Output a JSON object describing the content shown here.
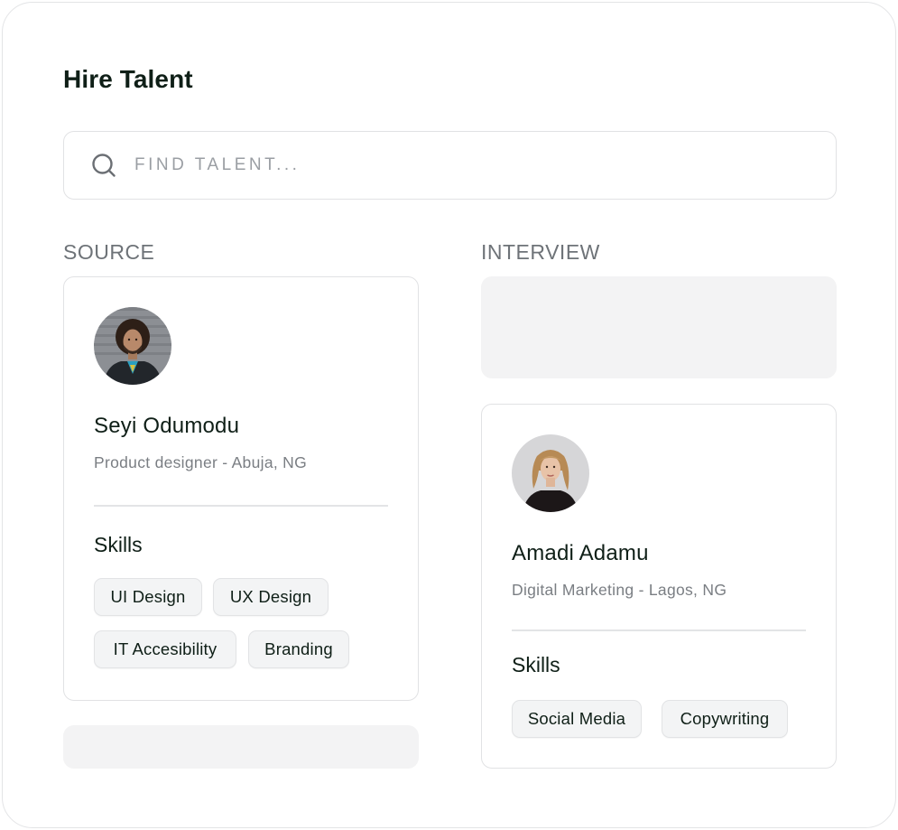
{
  "page": {
    "title": "Hire Talent"
  },
  "search": {
    "placeholder": "FIND TALENT..."
  },
  "columns": {
    "source": {
      "heading": "SOURCE"
    },
    "interview": {
      "heading": "INTERVIEW"
    }
  },
  "candidates": [
    {
      "name": "Seyi Odumodu",
      "subtitle": "Product designer - Abuja, NG",
      "skills_label": "Skills",
      "skills": [
        "UI Design",
        "UX Design",
        "IT Accesibility",
        "Branding"
      ]
    },
    {
      "name": "Amadi Adamu",
      "subtitle": "Digital Marketing - Lagos, NG",
      "skills_label": "Skills",
      "skills": [
        "Social Media",
        "Copywriting"
      ]
    }
  ],
  "icons": {
    "search": "search-icon"
  },
  "colors": {
    "text_primary": "#0f1f17",
    "text_muted": "#7a7e83",
    "border": "#e1e2e4",
    "placeholder_fill": "#f3f3f4"
  }
}
